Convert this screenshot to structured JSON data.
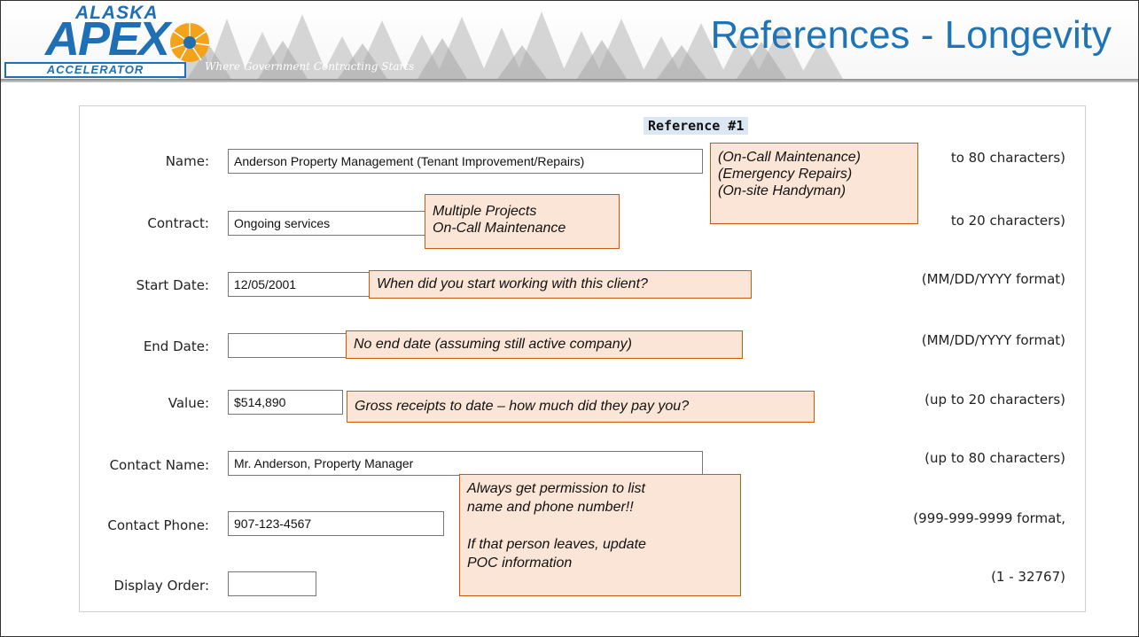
{
  "header": {
    "title": "References - Longevity",
    "logo": {
      "alaska": "ALASKA",
      "apex": "APEX",
      "accelerator": "ACCELERATOR",
      "tagline": "Where Government Contracting Starts"
    }
  },
  "form": {
    "heading": "Reference #1",
    "fields": {
      "name": {
        "label": "Name:",
        "value": "Anderson Property Management (Tenant Improvement/Repairs)",
        "hint": "to 80 characters)"
      },
      "contract": {
        "label": "Contract:",
        "value": "Ongoing services",
        "hint": "to 20 characters)"
      },
      "start_date": {
        "label": "Start Date:",
        "value": "12/05/2001",
        "hint": "(MM/DD/YYYY format)"
      },
      "end_date": {
        "label": "End Date:",
        "value": "",
        "hint": "(MM/DD/YYYY format)"
      },
      "value": {
        "label": "Value:",
        "value": "$514,890",
        "hint": "(up to 20 characters)"
      },
      "contact_name": {
        "label": "Contact Name:",
        "value": "Mr. Anderson, Property Manager",
        "hint": "(up to 80 characters)"
      },
      "contact_phone": {
        "label": "Contact Phone:",
        "value": "907-123-4567",
        "hint": "(999-999-9999 format,"
      },
      "display_order": {
        "label": "Display Order:",
        "value": "",
        "hint": "(1 - 32767)"
      }
    }
  },
  "notes": {
    "name_note": [
      "(On-Call Maintenance)",
      "(Emergency Repairs)",
      "(On-site Handyman)"
    ],
    "contract_note": [
      "Multiple Projects",
      "On-Call Maintenance"
    ],
    "start_note": "When did you start working with this client?",
    "end_note": "No end date (assuming still active company)",
    "value_note": "Gross receipts to date – how much did they pay you?",
    "contact_note": [
      "Always get permission to list",
      "name and phone number!!",
      "",
      "If that person leaves, update",
      "POC information"
    ]
  },
  "colors": {
    "title_blue": "#1f73b7",
    "note_fill": "#fbe5d6",
    "note_border": "#c55a11",
    "heading_fill": "#dbe8f4"
  }
}
